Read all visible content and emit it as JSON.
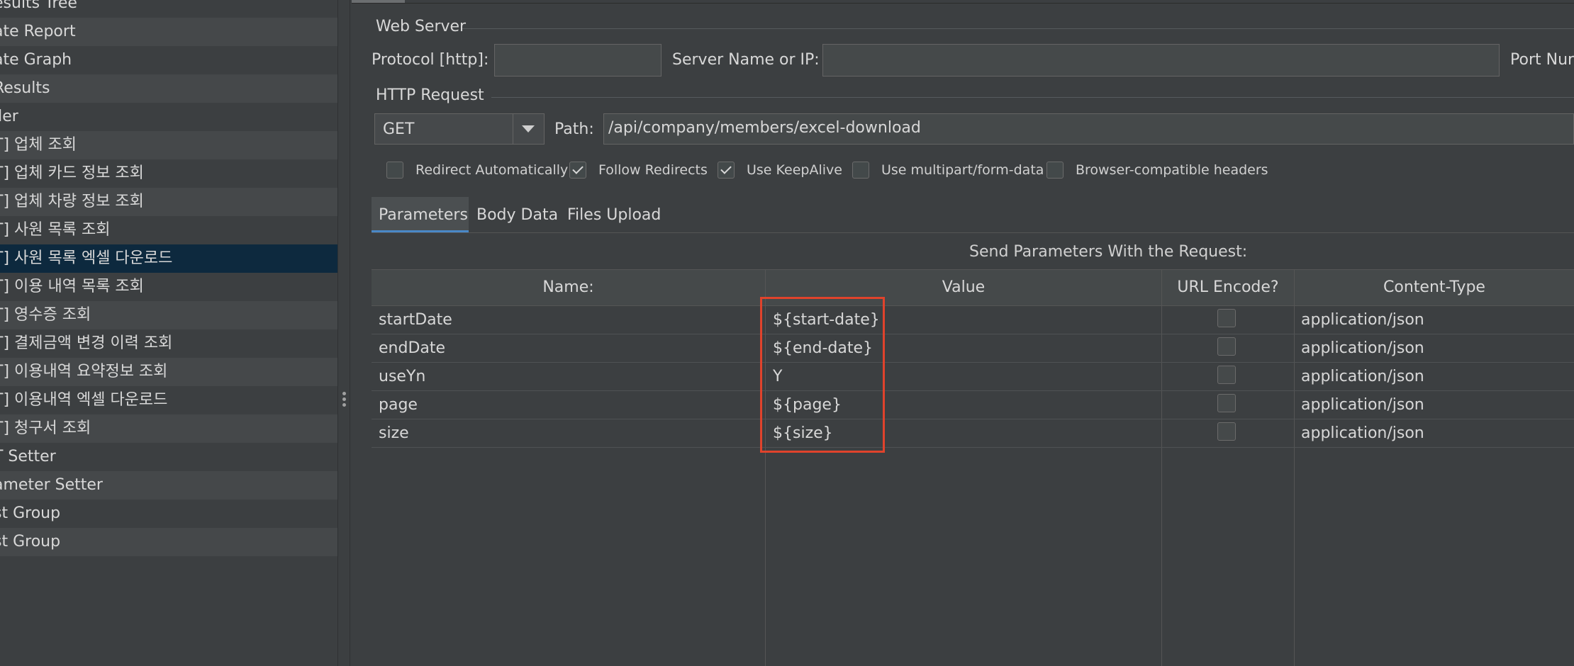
{
  "tree": {
    "items": [
      {
        "label": "esults Tree",
        "state": "normal"
      },
      {
        "label": "ate Report",
        "state": "alt"
      },
      {
        "label": "ate Graph",
        "state": "normal"
      },
      {
        "label": "Results",
        "state": "alt"
      },
      {
        "label": "ller",
        "state": "normal"
      },
      {
        "label": "T] 업체 조회",
        "state": "alt"
      },
      {
        "label": "T] 업체 카드 정보 조회",
        "state": "normal"
      },
      {
        "label": "T] 업체 차량 정보 조회",
        "state": "alt"
      },
      {
        "label": "T] 사원 목록 조회",
        "state": "normal"
      },
      {
        "label": "T] 사원 목록 엑셀 다운로드",
        "state": "selected"
      },
      {
        "label": "T] 이용 내역 목록 조회",
        "state": "normal"
      },
      {
        "label": "T] 영수증 조회",
        "state": "alt"
      },
      {
        "label": "T] 결제금액 변경 이력 조회",
        "state": "normal"
      },
      {
        "label": "T] 이용내역 요약정보 조회",
        "state": "alt"
      },
      {
        "label": "T] 이용내역 엑셀 다운로드",
        "state": "normal"
      },
      {
        "label": "T] 청구서 조회",
        "state": "alt"
      },
      {
        "label": "T Setter",
        "state": "normal"
      },
      {
        "label": "ameter Setter",
        "state": "alt"
      },
      {
        "label": "st Group",
        "state": "normal"
      },
      {
        "label": "st Group",
        "state": "alt"
      }
    ]
  },
  "web_server": {
    "title": "Web Server",
    "protocol_label": "Protocol [http]:",
    "protocol_value": "",
    "server_label": "Server Name or IP:",
    "server_value": "",
    "port_label": "Port Nur"
  },
  "http_request": {
    "title": "HTTP Request",
    "method": "GET",
    "path_label": "Path:",
    "path_value": "/api/company/members/excel-download",
    "options": [
      {
        "label": "Redirect Automatically",
        "checked": false
      },
      {
        "label": "Follow Redirects",
        "checked": true
      },
      {
        "label": "Use KeepAlive",
        "checked": true
      },
      {
        "label": "Use multipart/form-data",
        "checked": false
      },
      {
        "label": "Browser-compatible headers",
        "checked": false
      }
    ]
  },
  "tabs": [
    {
      "label": "Parameters",
      "active": true
    },
    {
      "label": "Body Data",
      "active": false
    },
    {
      "label": "Files Upload",
      "active": false
    }
  ],
  "params": {
    "caption": "Send Parameters With the Request:",
    "headers": {
      "name": "Name:",
      "value": "Value",
      "encode": "URL Encode?",
      "content_type": "Content-Type"
    },
    "rows": [
      {
        "name": "startDate",
        "value": "${start-date}",
        "encode": false,
        "content_type": "application/json"
      },
      {
        "name": "endDate",
        "value": "${end-date}",
        "encode": false,
        "content_type": "application/json"
      },
      {
        "name": "useYn",
        "value": "Y",
        "encode": false,
        "content_type": "application/json"
      },
      {
        "name": "page",
        "value": "${page}",
        "encode": false,
        "content_type": "application/json"
      },
      {
        "name": "size",
        "value": "${size}",
        "encode": false,
        "content_type": "application/json"
      }
    ]
  },
  "colors": {
    "highlight": "#e0432c",
    "selected_row": "#0d293e",
    "tab_underline": "#4a88c7"
  }
}
